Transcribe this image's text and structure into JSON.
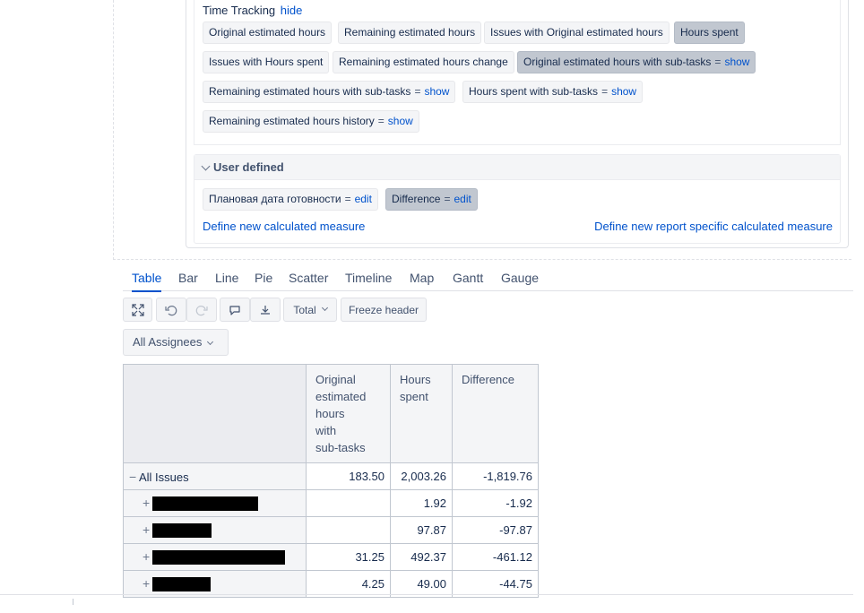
{
  "time_tracking": {
    "title": "Time Tracking",
    "toggle": "hide",
    "measures": [
      {
        "label": "Original estimated hours",
        "selected": false,
        "action": ""
      },
      {
        "label": "Remaining estimated hours",
        "selected": false,
        "action": ""
      },
      {
        "label": "Issues with Original estimated hours",
        "selected": false,
        "action": ""
      },
      {
        "label": "Hours spent",
        "selected": true,
        "action": ""
      },
      {
        "label": "Issues with Hours spent",
        "selected": false,
        "action": ""
      },
      {
        "label": "Remaining estimated hours change",
        "selected": false,
        "action": ""
      },
      {
        "label": "Original estimated hours with sub-tasks",
        "selected": true,
        "eq": "=",
        "action": "show"
      },
      {
        "label": "Remaining estimated hours with sub-tasks",
        "selected": false,
        "eq": "=",
        "action": "show"
      },
      {
        "label": "Hours spent with sub-tasks",
        "selected": false,
        "eq": "=",
        "action": "show"
      },
      {
        "label": "Remaining estimated hours history",
        "selected": false,
        "eq": "=",
        "action": "show"
      }
    ]
  },
  "user_defined": {
    "title": "User defined",
    "measures": [
      {
        "label": "Плановая дата готовности",
        "selected": false,
        "eq": "=",
        "action": "edit"
      },
      {
        "label": "Difference",
        "selected": true,
        "eq": "=",
        "action": "edit"
      }
    ],
    "define_new": "Define new calculated measure",
    "define_report": "Define new report specific calculated measure"
  },
  "tabs": [
    "Table",
    "Bar",
    "Line",
    "Pie",
    "Scatter",
    "Timeline",
    "Map",
    "Gantt",
    "Gauge"
  ],
  "active_tab": "Table",
  "toolbar": {
    "icons": [
      "fullscreen-icon",
      "undo-icon",
      "redo-icon",
      "comment-icon",
      "export-icon"
    ],
    "total_label": "Total",
    "freeze_label": "Freeze header"
  },
  "filter": {
    "label": "All Assignees"
  },
  "table": {
    "columns": [
      "Original estimated hours with sub-tasks",
      "Hours spent",
      "Difference"
    ],
    "column_lines": [
      [
        "Original",
        "estimated",
        "hours",
        "with",
        "sub-tasks"
      ],
      [
        "Hours",
        "spent"
      ],
      [
        "Difference"
      ]
    ],
    "rows": [
      {
        "label": "All Issues",
        "expander": "−",
        "redacted": false,
        "values": [
          "183.50",
          "2,003.26",
          "-1,819.76"
        ]
      },
      {
        "label": "",
        "expander": "+",
        "redacted": true,
        "values": [
          "",
          "1.92",
          "-1.92"
        ]
      },
      {
        "label": "",
        "expander": "+",
        "redacted": true,
        "values": [
          "",
          "97.87",
          "-97.87"
        ]
      },
      {
        "label": "",
        "expander": "+",
        "redacted": true,
        "values": [
          "31.25",
          "492.37",
          "-461.12"
        ]
      },
      {
        "label": "",
        "expander": "+",
        "redacted": true,
        "values": [
          "4.25",
          "49.00",
          "-44.75"
        ]
      }
    ]
  }
}
